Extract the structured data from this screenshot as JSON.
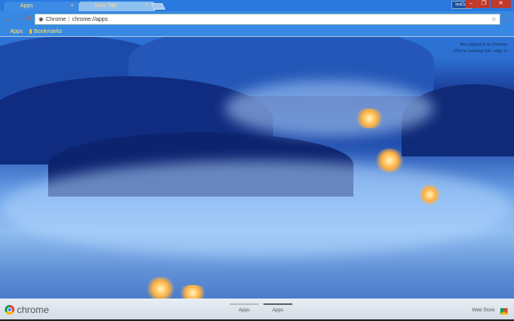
{
  "tabs": [
    {
      "label": "Apps",
      "active": true
    },
    {
      "label": "New Tab",
      "active": false
    }
  ],
  "window": {
    "user_label": "lonDay"
  },
  "omnibox": {
    "site": "Chrome",
    "url": "chrome://apps"
  },
  "bookmarks": [
    {
      "label": "Apps",
      "icon": "apps-grid-icon"
    },
    {
      "label": "Bookmarks",
      "icon": "folder-icon"
    }
  ],
  "signin": {
    "line1": "Not signed in to Chrome",
    "line2_prefix": "(You're missing out—",
    "line2_link": "sign in"
  },
  "footer": {
    "brand": "chrome",
    "pages": [
      {
        "label": "Apps",
        "active": false
      },
      {
        "label": "Apps",
        "active": true
      }
    ],
    "webstore": "Web Store"
  },
  "colors": {
    "accent": "#e25a2a",
    "tab_text": "#ffe36b",
    "close_button": "#c0392b"
  }
}
